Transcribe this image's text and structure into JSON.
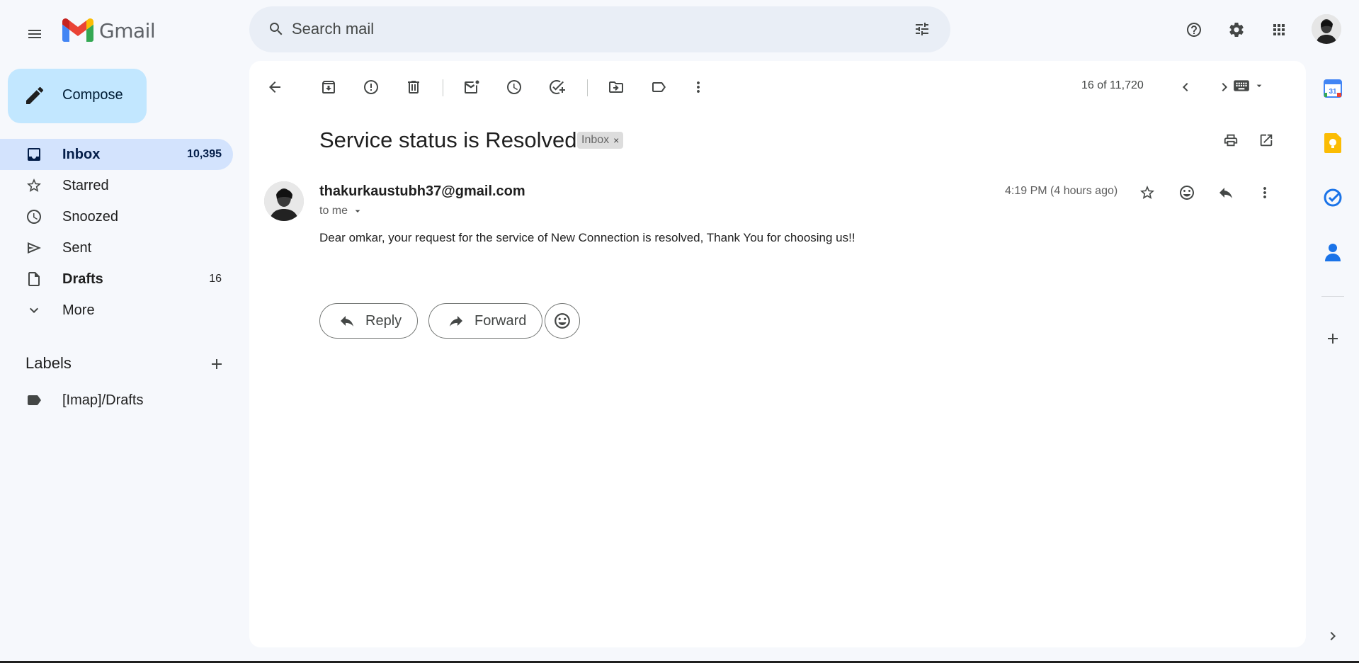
{
  "app": {
    "logo_text": "Gmail",
    "colors": {
      "compose_bg": "#c2e7ff",
      "active_nav": "#d3e3fd",
      "search_bg": "#e9eef6",
      "page_bg": "#f6f8fc"
    }
  },
  "search": {
    "placeholder": "Search mail",
    "value": ""
  },
  "sidebar": {
    "compose_label": "Compose",
    "items": [
      {
        "label": "Inbox",
        "count": "10,395",
        "icon": "inbox-icon",
        "active": true
      },
      {
        "label": "Starred",
        "count": "",
        "icon": "star-icon"
      },
      {
        "label": "Snoozed",
        "count": "",
        "icon": "clock-icon"
      },
      {
        "label": "Sent",
        "count": "",
        "icon": "send-icon"
      },
      {
        "label": "Drafts",
        "count": "16",
        "icon": "draft-icon"
      },
      {
        "label": "More",
        "count": "",
        "icon": "chevron-down-icon"
      }
    ],
    "labels_heading": "Labels",
    "labels": [
      {
        "label": "[Imap]/Drafts",
        "icon": "label-icon"
      }
    ]
  },
  "toolbar": {
    "pager": "16 of 11,720"
  },
  "message": {
    "subject": "Service status is Resolved",
    "label_chip": "Inbox",
    "label_chip_remove": "×",
    "sender_email": "thakurkaustubh37@gmail.com",
    "recipient": "to me",
    "timestamp": "4:19 PM (4 hours ago)",
    "body": "Dear omkar, your request for the service of New Connection is resolved, Thank You for choosing us!!",
    "reply_label": "Reply",
    "forward_label": "Forward"
  },
  "side_panel": {
    "calendar_day": "31",
    "apps": [
      "calendar-icon",
      "keep-icon",
      "tasks-icon",
      "contacts-icon"
    ]
  }
}
